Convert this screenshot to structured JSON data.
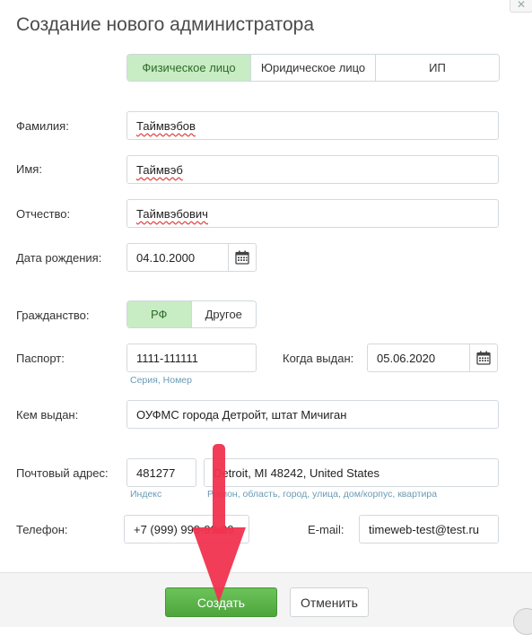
{
  "dialog": {
    "title": "Создание нового администратора",
    "close_glyph": "✕"
  },
  "person_type": {
    "options": [
      "Физическое лицо",
      "Юридическое лицо",
      "ИП"
    ],
    "selected": "Физическое лицо"
  },
  "fields": {
    "last_name": {
      "label": "Фамилия:",
      "value": "Таймвэбов"
    },
    "first_name": {
      "label": "Имя:",
      "value": "Таймвэб"
    },
    "patronymic": {
      "label": "Отчество:",
      "value": "Таймвэбович"
    },
    "birth_date": {
      "label": "Дата рождения:",
      "value": "04.10.2000"
    },
    "citizenship": {
      "label": "Гражданство:",
      "options": [
        "РФ",
        "Другое"
      ],
      "selected": "РФ"
    },
    "passport": {
      "label": "Паспорт:",
      "value": "1111-111111",
      "hint": "Серия, Номер"
    },
    "issue_date": {
      "label": "Когда выдан:",
      "value": "05.06.2020"
    },
    "issued_by": {
      "label": "Кем выдан:",
      "value": "ОУФМС города Детройт, штат Мичиган"
    },
    "postal": {
      "label": "Почтовый адрес:",
      "index_value": "481277",
      "index_hint": "Индекс",
      "address_value": "Detroit, MI 48242, United States",
      "address_hint": "Регион, область, город, улица, дом/корпус, квартира"
    },
    "phone": {
      "label": "Телефон:",
      "value": "+7 (999) 999-99-99"
    },
    "email": {
      "label": "E-mail:",
      "value": "timeweb-test@test.ru"
    }
  },
  "footer": {
    "create_label": "Создать",
    "cancel_label": "Отменить"
  },
  "icons": {
    "calendar": "calendar-icon",
    "arrow": "arrow-down-annotation",
    "close": "close-icon"
  },
  "colors": {
    "active_segment": "#c8ecc4",
    "create_button": "#4da53c",
    "annotation_arrow": "#f0334f",
    "hint_text": "#6a9bb5"
  }
}
